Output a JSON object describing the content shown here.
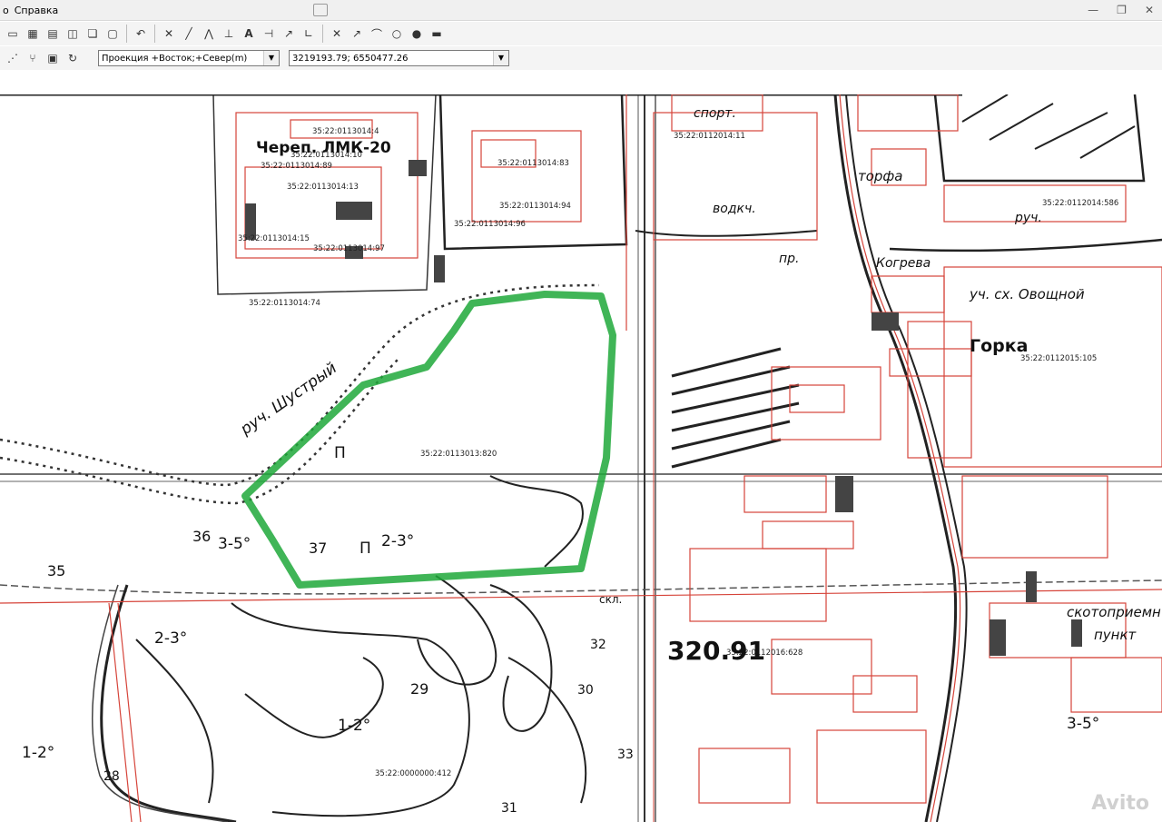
{
  "menu": {
    "item_file_partial": "о",
    "item_help": "Справка"
  },
  "toolbar": {
    "projection_select": "Проекция +Восток;+Север(m)",
    "coordinates_field": "3219193.79; 6550477.26"
  },
  "map": {
    "cadastral_labels": [
      "35:22:0113014:4",
      "35:22:0113014:10",
      "35:22:0113014:89",
      "35:22:0113014:13",
      "35:22:0113014:15",
      "35:22:0113014:97",
      "35:22:0113014:74",
      "35:22:0113014:83",
      "35:22:0113014:94",
      "35:22:0113014:96",
      "35:22:0113013:820",
      "35:22:0112015:105",
      "35:22:0112014:11",
      "35:22:0112014:586",
      "35:22:0000000:412",
      "35:22:0112016:628"
    ],
    "place_labels": {
      "gorka": "Горка",
      "plot_vegetable": "уч. сх. Овощной",
      "stream": "руч. Шустрый",
      "stream2": "руч.",
      "cherep": "Череп. ЛМК-20",
      "sport": "спорт.",
      "torfa": "торфа",
      "pr": "пр.",
      "kogreva": "Когрева",
      "cattle": "скотоприемн",
      "punkt": "пункт",
      "sklad": "скл.",
      "vodokach": "водкч.",
      "p1": "П",
      "p2": "П",
      "slope1": "2-3°",
      "slope2": "2-3°",
      "slope3": "1-2°",
      "slope4": "1-2°",
      "slope5": "3-5°",
      "slope6": "3-5°",
      "n36": "36",
      "n37": "37",
      "n35": "35",
      "n29": "29",
      "n30": "30",
      "n28": "28",
      "n31": "31",
      "n33": "33",
      "n32": "32",
      "big_number": "320.91"
    },
    "highlight_color": "#1fa83a",
    "boundary_color": "#d6443a"
  },
  "watermark": "Avito"
}
